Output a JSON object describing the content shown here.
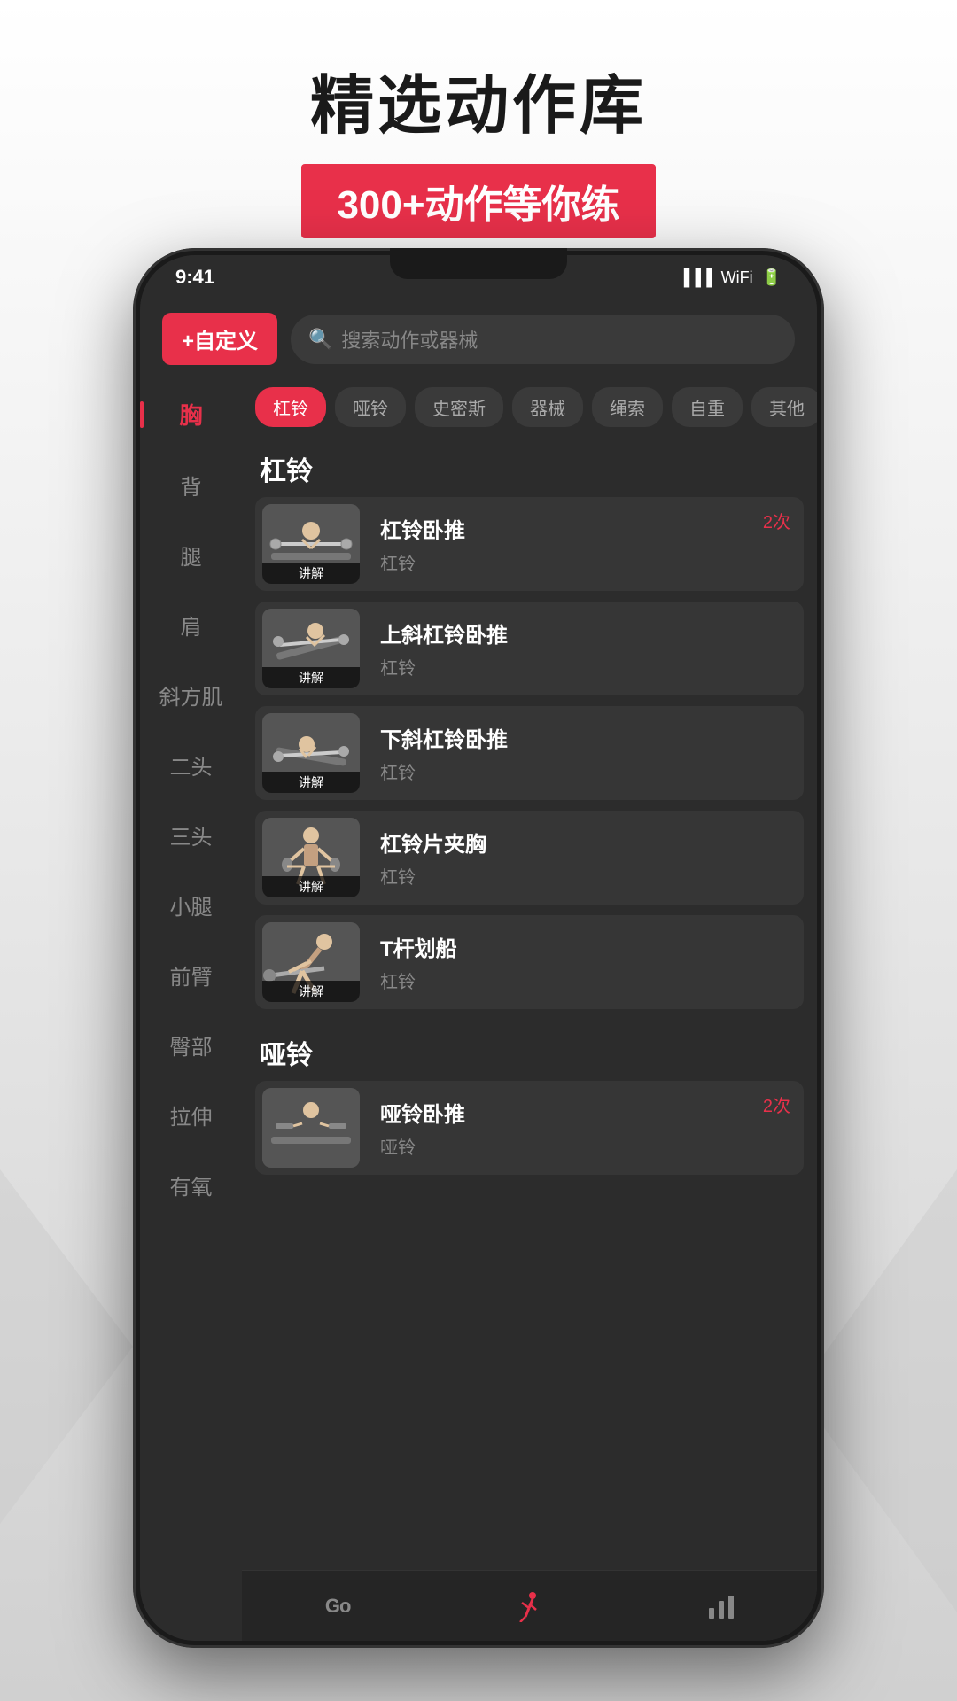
{
  "page": {
    "title": "精选动作库",
    "subtitle": "300+动作等你练"
  },
  "topbar": {
    "custom_label": "+自定义",
    "search_placeholder": "搜索动作或器械"
  },
  "sidebar": {
    "items": [
      {
        "label": "胸",
        "active": true
      },
      {
        "label": "背",
        "active": false
      },
      {
        "label": "腿",
        "active": false
      },
      {
        "label": "肩",
        "active": false
      },
      {
        "label": "斜方肌",
        "active": false
      },
      {
        "label": "二头",
        "active": false
      },
      {
        "label": "三头",
        "active": false
      },
      {
        "label": "小腿",
        "active": false
      },
      {
        "label": "前臂",
        "active": false
      },
      {
        "label": "臀部",
        "active": false
      },
      {
        "label": "拉伸",
        "active": false
      },
      {
        "label": "有氧",
        "active": false
      }
    ]
  },
  "filters": {
    "items": [
      {
        "label": "杠铃",
        "active": true
      },
      {
        "label": "哑铃",
        "active": false
      },
      {
        "label": "史密斯",
        "active": false
      },
      {
        "label": "器械",
        "active": false
      },
      {
        "label": "绳索",
        "active": false
      },
      {
        "label": "自重",
        "active": false
      },
      {
        "label": "其他",
        "active": false
      }
    ]
  },
  "sections": [
    {
      "title": "杠铃",
      "exercises": [
        {
          "name": "杠铃卧推",
          "equipment": "杠铃",
          "count": "2次",
          "has_tutorial": true
        },
        {
          "name": "上斜杠铃卧推",
          "equipment": "杠铃",
          "count": "",
          "has_tutorial": true
        },
        {
          "name": "下斜杠铃卧推",
          "equipment": "杠铃",
          "count": "",
          "has_tutorial": true
        },
        {
          "name": "杠铃片夹胸",
          "equipment": "杠铃",
          "count": "",
          "has_tutorial": true
        },
        {
          "name": "T杆划船",
          "equipment": "杠铃",
          "count": "",
          "has_tutorial": true
        }
      ]
    },
    {
      "title": "哑铃",
      "exercises": [
        {
          "name": "哑铃卧推",
          "equipment": "哑铃",
          "count": "2次",
          "has_tutorial": false
        }
      ]
    }
  ],
  "bottom_nav": {
    "items": [
      {
        "label": "Go",
        "icon": "go",
        "active": false
      },
      {
        "label": "",
        "icon": "run",
        "active": true
      },
      {
        "label": "",
        "icon": "chart",
        "active": false
      }
    ]
  },
  "tutorial_label": "讲解",
  "colors": {
    "accent": "#e8304a",
    "bg_dark": "#2c2c2c",
    "card_bg": "#363636"
  }
}
